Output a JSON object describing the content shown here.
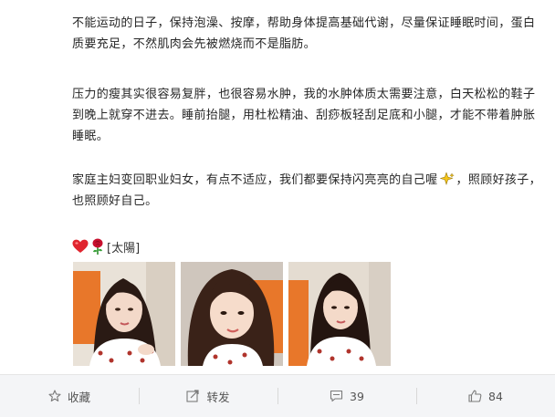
{
  "post": {
    "paragraph_1": "不能运动的日子，保持泡澡、按摩，帮助身体提高基础代谢，尽量保证睡眠时间，蛋白质要充足，不然肌肉会先被燃烧而不是脂肪。",
    "paragraph_2": "压力的瘦其实很容易复胖，也很容易水肿，我的水肿体质太需要注意，白天松松的鞋子到晚上就穿不进去。睡前抬腿，用杜松精油、刮痧板轻刮足底和小腿，才能不带着肿胀睡眠。",
    "paragraph_3_before_icon": "家庭主妇变回职业妇女，有点不适应，我们都要保持闪亮亮的自己喔",
    "paragraph_3_after_icon": "，照顾好孩子，也照顾好自己。",
    "emoji_text": "[太陽]",
    "icons": [
      "heart-icon",
      "rose-icon",
      "sparkle-icon"
    ]
  },
  "actions": {
    "favorite_label": "收藏",
    "repost_label": "转发",
    "comment_count": "39",
    "like_count": "84"
  },
  "colors": {
    "action_bar_bg": "#f4f5f7",
    "heart": "#e0242e",
    "rose": "#c8102e",
    "sparkle": "#f5c518"
  }
}
